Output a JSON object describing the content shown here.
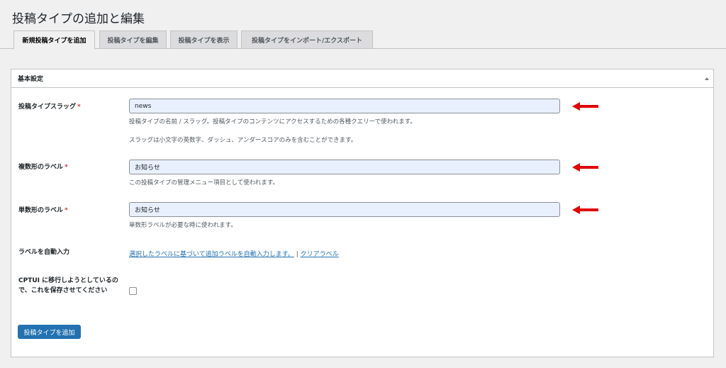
{
  "page_title": "投稿タイプの追加と編集",
  "tabs": [
    {
      "label": "新規投稿タイプを追加",
      "active": true
    },
    {
      "label": "投稿タイプを編集",
      "active": false
    },
    {
      "label": "投稿タイプを表示",
      "active": false
    },
    {
      "label": "投稿タイプをインポート/エクスポート",
      "active": false
    }
  ],
  "section": {
    "title": "基本設定"
  },
  "fields": {
    "slug": {
      "label": "投稿タイプスラッグ",
      "required_mark": "*",
      "value": "news",
      "help1": "投稿タイプの名前 / スラッグ。投稿タイプのコンテンツにアクセスするための各種クエリーで使われます。",
      "help2": "スラッグは小文字の英数字、ダッシュ、アンダースコアのみを含むことができます。"
    },
    "plural": {
      "label": "複数形のラベル",
      "required_mark": "*",
      "value": "お知らせ",
      "help": "この投稿タイプの管理メニュー項目として使われます。"
    },
    "singular": {
      "label": "単数形のラベル",
      "required_mark": "*",
      "value": "お知らせ",
      "help": "単数形ラベルが必要な時に使われます。"
    },
    "autopopulate": {
      "label": "ラベルを自動入力",
      "link1": "選択したラベルに基づいて追加ラベルを自動入力します。",
      "separator": "|",
      "link2": "クリアラベル"
    },
    "migrate": {
      "label": "CPTUI に移行しようとしているので、これを保存させてください",
      "checked": false
    }
  },
  "submit_label": "投稿タイプを追加",
  "colors": {
    "accent": "#2271b1",
    "arrow": "#e00000",
    "required": "#d63638",
    "input_bg": "#e8f0fe"
  }
}
